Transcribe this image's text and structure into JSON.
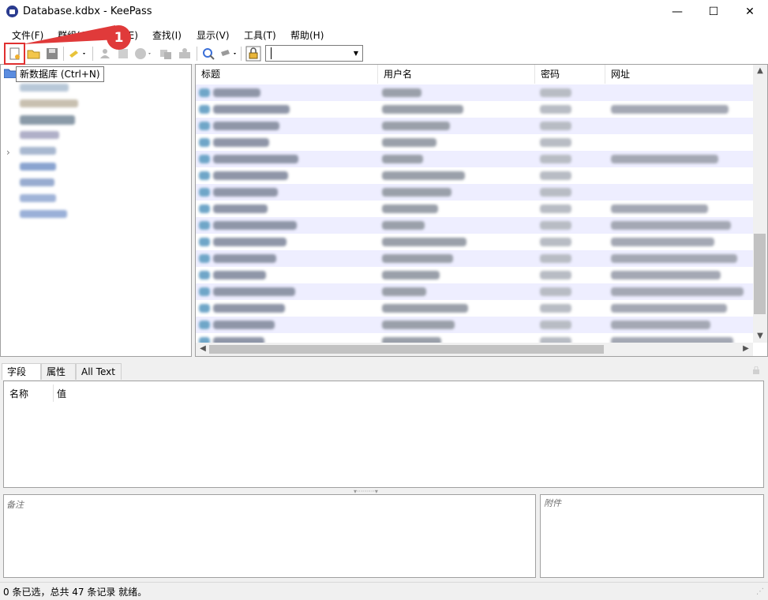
{
  "window": {
    "title": "Database.kdbx - KeePass",
    "minimize": "—",
    "maximize": "☐",
    "close": "✕"
  },
  "menu": [
    "文件(F)",
    "群组(G)",
    "记录(E)",
    "查找(I)",
    "显示(V)",
    "工具(T)",
    "帮助(H)"
  ],
  "toolbar": {
    "icons": [
      "new-database-icon",
      "open-folder-icon",
      "save-icon",
      "add-entry-icon",
      "copy-username-icon",
      "copy-password-icon",
      "open-url-icon",
      "duplicate-icon",
      "autotype-icon",
      "find-icon",
      "tools-icon",
      "lock-icon"
    ],
    "tooltip": "新数据库 (Ctrl+N)",
    "quickfind_value": ""
  },
  "annotation": {
    "badge": "1",
    "color": "#e03a3a"
  },
  "list": {
    "columns": [
      "标题",
      "用户名",
      "密码",
      "网址"
    ],
    "alt_row_color": "#eeeeff"
  },
  "tabs": [
    "字段",
    "属性",
    "All Text"
  ],
  "fields": {
    "col_name": "名称",
    "col_value": "值"
  },
  "notes_label": "备注",
  "attachments_label": "附件",
  "status": "0 条已选，总共 47 条记录 就绪。",
  "colors": {
    "accent": "#3a6fd8",
    "highlight": "#e03030"
  }
}
